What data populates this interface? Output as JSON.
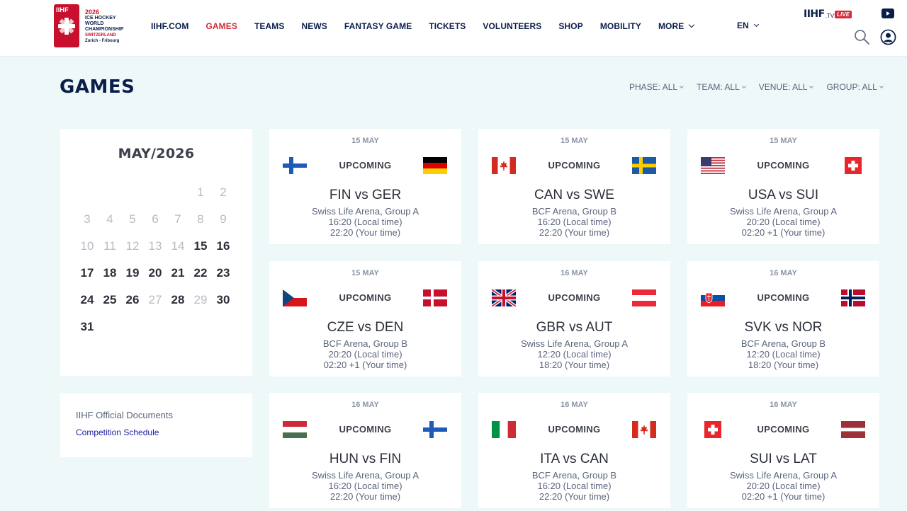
{
  "header": {
    "logo": {
      "top": "IIHF",
      "year": "2026",
      "line1": "ICE HOCKEY",
      "line2": "WORLD",
      "line3": "CHAMPIONSHIP",
      "country": "SWITZERLAND",
      "cities": "Zurich - Fribourg"
    },
    "nav": [
      {
        "label": "IIHF.COM"
      },
      {
        "label": "GAMES",
        "active": true
      },
      {
        "label": "TEAMS"
      },
      {
        "label": "NEWS"
      },
      {
        "label": "FANTASY GAME"
      },
      {
        "label": "TICKETS"
      },
      {
        "label": "VOLUNTEERS"
      },
      {
        "label": "SHOP"
      },
      {
        "label": "MOBILITY"
      },
      {
        "label": "MORE"
      }
    ],
    "language": "EN",
    "tv": {
      "brand": "IIHF",
      "tv": ".TV",
      "live": "LIVE"
    }
  },
  "page": {
    "title": "GAMES",
    "filters": [
      "PHASE: ALL",
      "TEAM: ALL",
      "VENUE: ALL",
      "GROUP: ALL"
    ]
  },
  "calendar": {
    "title": "MAY/2026",
    "days": [
      {
        "d": "1",
        "on": false
      },
      {
        "d": "2",
        "on": false
      },
      {
        "d": "3",
        "on": false
      },
      {
        "d": "4",
        "on": false
      },
      {
        "d": "5",
        "on": false
      },
      {
        "d": "6",
        "on": false
      },
      {
        "d": "7",
        "on": false
      },
      {
        "d": "8",
        "on": false
      },
      {
        "d": "9",
        "on": false
      },
      {
        "d": "10",
        "on": false
      },
      {
        "d": "11",
        "on": false
      },
      {
        "d": "12",
        "on": false
      },
      {
        "d": "13",
        "on": false
      },
      {
        "d": "14",
        "on": false
      },
      {
        "d": "15",
        "on": true
      },
      {
        "d": "16",
        "on": true
      },
      {
        "d": "17",
        "on": true
      },
      {
        "d": "18",
        "on": true
      },
      {
        "d": "19",
        "on": true
      },
      {
        "d": "20",
        "on": true
      },
      {
        "d": "21",
        "on": true
      },
      {
        "d": "22",
        "on": true
      },
      {
        "d": "23",
        "on": true
      },
      {
        "d": "24",
        "on": true
      },
      {
        "d": "25",
        "on": true
      },
      {
        "d": "26",
        "on": true
      },
      {
        "d": "27",
        "on": false
      },
      {
        "d": "28",
        "on": true
      },
      {
        "d": "29",
        "on": false
      },
      {
        "d": "30",
        "on": true
      },
      {
        "d": "31",
        "on": true
      }
    ]
  },
  "documents": {
    "title": "IIHF Official Documents",
    "link": "Competition Schedule"
  },
  "games": [
    {
      "date": "15 MAY",
      "status": "UPCOMING",
      "home": "FIN",
      "away": "GER",
      "teams": "FIN vs GER",
      "venue": "Swiss Life Arena, Group A",
      "local": "16:20 (Local time)",
      "yours": "22:20 (Your time)"
    },
    {
      "date": "15 MAY",
      "status": "UPCOMING",
      "home": "CAN",
      "away": "SWE",
      "teams": "CAN vs SWE",
      "venue": "BCF Arena, Group B",
      "local": "16:20 (Local time)",
      "yours": "22:20 (Your time)"
    },
    {
      "date": "15 MAY",
      "status": "UPCOMING",
      "home": "USA",
      "away": "SUI",
      "teams": "USA vs SUI",
      "venue": "Swiss Life Arena, Group A",
      "local": "20:20 (Local time)",
      "yours": "02:20 +1 (Your time)"
    },
    {
      "date": "15 MAY",
      "status": "UPCOMING",
      "home": "CZE",
      "away": "DEN",
      "teams": "CZE vs DEN",
      "venue": "BCF Arena, Group B",
      "local": "20:20 (Local time)",
      "yours": "02:20 +1 (Your time)"
    },
    {
      "date": "16 MAY",
      "status": "UPCOMING",
      "home": "GBR",
      "away": "AUT",
      "teams": "GBR vs AUT",
      "venue": "Swiss Life Arena, Group A",
      "local": "12:20 (Local time)",
      "yours": "18:20 (Your time)"
    },
    {
      "date": "16 MAY",
      "status": "UPCOMING",
      "home": "SVK",
      "away": "NOR",
      "teams": "SVK vs NOR",
      "venue": "BCF Arena, Group B",
      "local": "12:20 (Local time)",
      "yours": "18:20 (Your time)"
    },
    {
      "date": "16 MAY",
      "status": "UPCOMING",
      "home": "HUN",
      "away": "FIN",
      "teams": "HUN vs FIN",
      "venue": "Swiss Life Arena, Group A",
      "local": "16:20 (Local time)",
      "yours": "22:20 (Your time)"
    },
    {
      "date": "16 MAY",
      "status": "UPCOMING",
      "home": "ITA",
      "away": "CAN",
      "teams": "ITA vs CAN",
      "venue": "BCF Arena, Group B",
      "local": "16:20 (Local time)",
      "yours": "22:20 (Your time)"
    },
    {
      "date": "16 MAY",
      "status": "UPCOMING",
      "home": "SUI",
      "away": "LAT",
      "teams": "SUI vs LAT",
      "venue": "Swiss Life Arena, Group A",
      "local": "20:20 (Local time)",
      "yours": "02:20 +1 (Your time)"
    }
  ],
  "colors": {
    "navy": "#0b1e4a",
    "red": "#d12b3b",
    "page_bg": "#eef8f9"
  }
}
